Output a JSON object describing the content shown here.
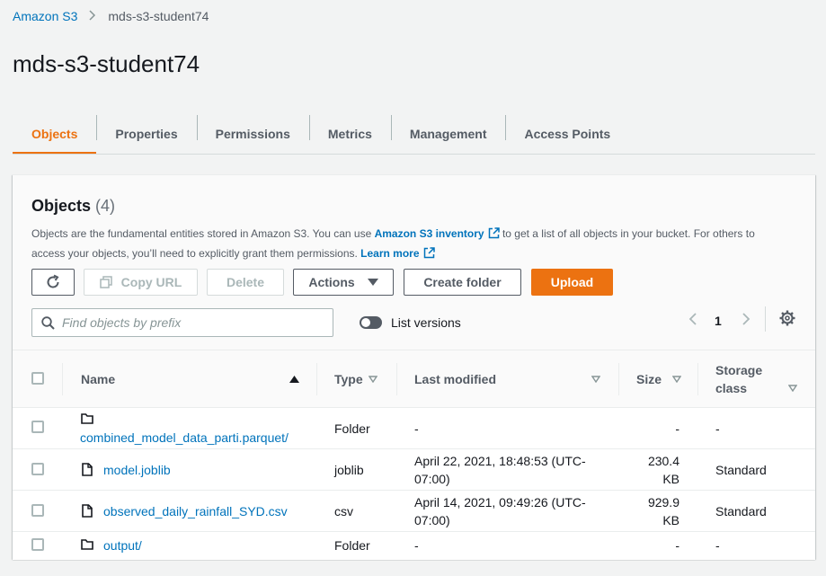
{
  "breadcrumb": {
    "root": "Amazon S3",
    "current": "mds-s3-student74"
  },
  "page_title": "mds-s3-student74",
  "tabs": [
    "Objects",
    "Properties",
    "Permissions",
    "Metrics",
    "Management",
    "Access Points"
  ],
  "active_tab": "Objects",
  "objects_panel": {
    "title": "Objects",
    "count": "(4)",
    "description_1": "Objects are the fundamental entities stored in Amazon S3. You can use ",
    "inventory_link": "Amazon S3 inventory",
    "description_2": " to get a list of all objects in your bucket. For others to access your objects, you’ll need to explicitly grant them permissions. ",
    "learn_more": "Learn more"
  },
  "toolbar": {
    "refresh_icon": "refresh-icon",
    "copy_url": "Copy URL",
    "delete": "Delete",
    "actions": "Actions",
    "create_folder": "Create folder",
    "upload": "Upload"
  },
  "search": {
    "placeholder": "Find objects by prefix"
  },
  "list_versions": {
    "label": "List versions",
    "enabled": false
  },
  "pagination": {
    "current_page": "1"
  },
  "table": {
    "columns": {
      "name": "Name",
      "type": "Type",
      "last_modified": "Last modified",
      "size": "Size",
      "storage_class_1": "Storage",
      "storage_class_2": "class"
    },
    "rows": [
      {
        "icon": "folder-icon",
        "name": "combined_model_data_parti.parquet/",
        "type": "Folder",
        "modified_1": "-",
        "modified_2": "",
        "size_1": "-",
        "size_2": "",
        "storage": "-"
      },
      {
        "icon": "file-icon",
        "name": "model.joblib",
        "type": "joblib",
        "modified_1": "April 22, 2021, 18:48:53 (UTC-",
        "modified_2": "07:00)",
        "size_1": "230.4",
        "size_2": "KB",
        "storage": "Standard"
      },
      {
        "icon": "file-icon",
        "name": "observed_daily_rainfall_SYD.csv",
        "type": "csv",
        "modified_1": "April 14, 2021, 09:49:26 (UTC-",
        "modified_2": "07:00)",
        "size_1": "929.9",
        "size_2": "KB",
        "storage": "Standard"
      },
      {
        "icon": "folder-icon",
        "name": "output/",
        "type": "Folder",
        "modified_1": "-",
        "modified_2": "",
        "size_1": "-",
        "size_2": "",
        "storage": "-"
      }
    ]
  },
  "colors": {
    "accent": "#ec7211",
    "link": "#0073bb"
  }
}
